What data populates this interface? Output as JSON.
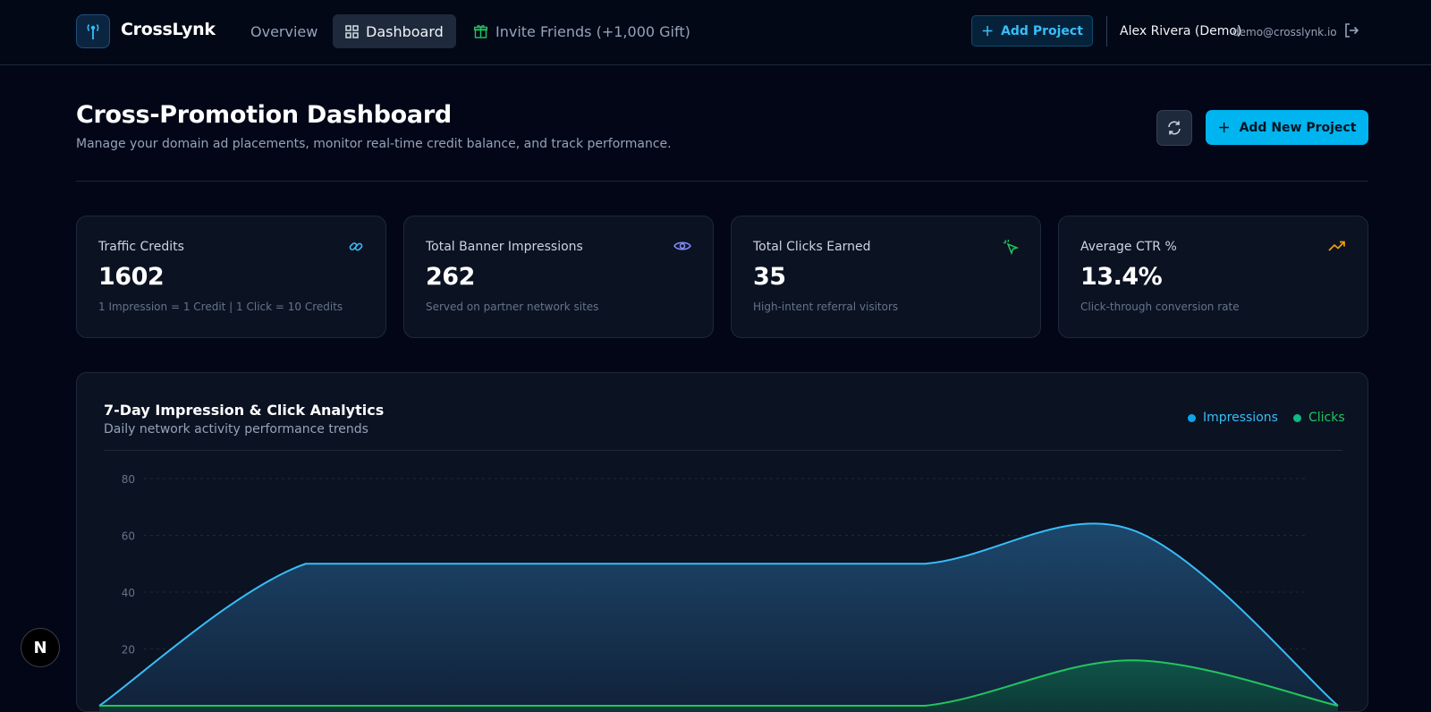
{
  "nav": {
    "brand": "CrossLynk",
    "links": [
      "Overview",
      "Dashboard",
      "Invite Friends (+1,000 Gift)"
    ],
    "add_project": "Add Project",
    "user_name": "Alex Rivera (Demo)",
    "user_email": "demo@crosslynk.io"
  },
  "header": {
    "title": "Cross-Promotion Dashboard",
    "subtitle": "Manage your domain ad placements, monitor real-time credit balance, and track performance.",
    "add_new_project": "Add New Project"
  },
  "stats": [
    {
      "label": "Traffic Credits",
      "value": "1602",
      "foot": "1 Impression = 1 Credit | 1 Click = 10 Credits",
      "icon": "link-icon",
      "color": "#38bdf8"
    },
    {
      "label": "Total Banner Impressions",
      "value": "262",
      "foot": "Served on partner network sites",
      "icon": "eye-icon",
      "color": "#818cf8"
    },
    {
      "label": "Total Clicks Earned",
      "value": "35",
      "foot": "High-intent referral visitors",
      "icon": "pointer-icon",
      "color": "#22c55e"
    },
    {
      "label": "Average CTR %",
      "value": "13.4%",
      "foot": "Click-through conversion rate",
      "icon": "trending-up-icon",
      "color": "#f59e0b"
    }
  ],
  "chart": {
    "title": "7-Day Impression & Click Analytics",
    "subtitle": "Daily network activity performance trends",
    "legend": [
      "Impressions",
      "Clicks"
    ]
  },
  "chart_data": {
    "type": "area",
    "title": "7-Day Impression & Click Analytics",
    "ylim": [
      0,
      80
    ],
    "yticks": [
      20,
      40,
      60,
      80
    ],
    "grid": true,
    "legend_position": "top-right",
    "series": [
      {
        "name": "Impressions",
        "color": "#38bdf8",
        "values": [
          0,
          50,
          50,
          50,
          50,
          62,
          0
        ]
      },
      {
        "name": "Clicks",
        "color": "#22c55e",
        "values": [
          0,
          0,
          0,
          0,
          0,
          16,
          0
        ]
      }
    ]
  },
  "badge": "N"
}
